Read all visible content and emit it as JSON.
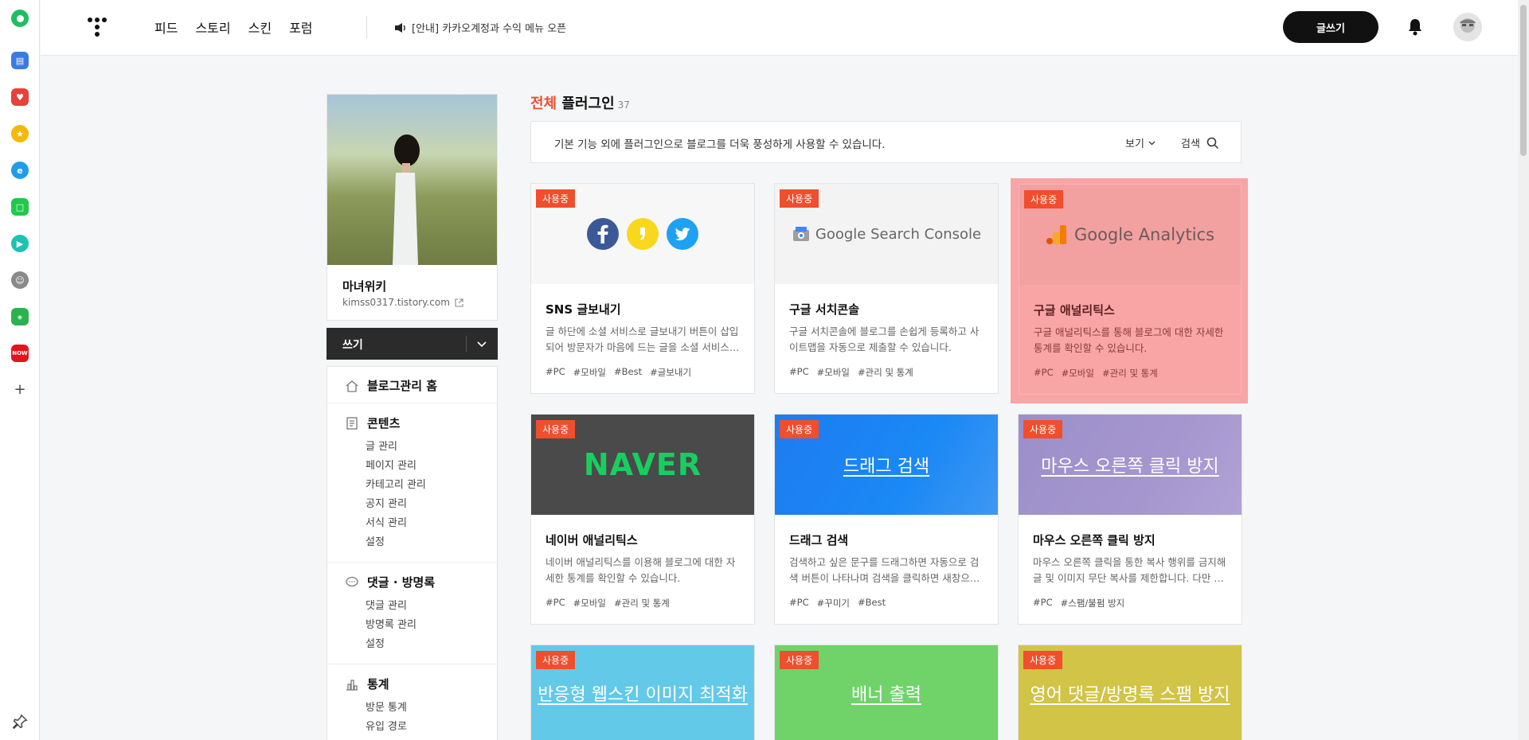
{
  "nav": {
    "items": [
      "피드",
      "스토리",
      "스킨",
      "포럼"
    ]
  },
  "notice": {
    "text": "[안내] 카카오계정과 수익 메뉴 오픈"
  },
  "header": {
    "write_label": "글쓰기"
  },
  "profile": {
    "blog_name": "마녀위키",
    "url": "kimss0317.tistory.com"
  },
  "write_bar": {
    "label": "쓰기"
  },
  "menu": {
    "home": "블로그관리 홈",
    "content": {
      "title": "콘텐츠",
      "items": [
        "글 관리",
        "페이지 관리",
        "카테고리 관리",
        "공지 관리",
        "서식 관리",
        "설정"
      ]
    },
    "comments": {
      "title": "댓글 · 방명록",
      "items": [
        "댓글 관리",
        "방명록 관리",
        "설정"
      ]
    },
    "stats": {
      "title": "통계",
      "items": [
        "방문 통계",
        "유입 경로"
      ]
    }
  },
  "main": {
    "title_accent": "전체",
    "title": "플러그인",
    "count": "37",
    "description": "기본 기능 외에 플러그인으로 블로그를 더욱 풍성하게 사용할 수 있습니다.",
    "view_label": "보기",
    "search_label": "검색"
  },
  "cards": [
    {
      "badge": "사용중",
      "title": "SNS 글보내기",
      "desc": "글 하단에 소셜 서비스로 글보내기 버튼이 삽입되어 방문자가 마음에 드는 글을 소셜 서비스…",
      "tags": [
        "#PC",
        "#모바일",
        "#Best",
        "#글보내기"
      ]
    },
    {
      "badge": "사용중",
      "title": "구글 서치콘솔",
      "logo_text": "Google Search Console",
      "desc": "구글 서치콘솔에 블로그를 손쉽게 등록하고 사이트맵을 자동으로 제출할 수 있습니다.",
      "tags": [
        "#PC",
        "#모바일",
        "#관리 및 통계"
      ]
    },
    {
      "badge": "사용중",
      "title": "구글 애널리틱스",
      "logo_text": "Google Analytics",
      "desc": "구글 애널리틱스를 통해 블로그에 대한 자세한 통계를 확인할 수 있습니다.",
      "tags": [
        "#PC",
        "#모바일",
        "#관리 및 통계"
      ]
    },
    {
      "badge": "사용중",
      "title": "네이버 애널리틱스",
      "logo_text": "NAVER",
      "desc": "네이버 애널리틱스를 이용해 블로그에 대한 자세한 통계를 확인할 수 있습니다.",
      "tags": [
        "#PC",
        "#모바일",
        "#관리 및 통계"
      ]
    },
    {
      "badge": "사용중",
      "title": "드래그 검색",
      "top_text": "드래그 검색",
      "desc": "검색하고 싶은 문구를 드래그하면 자동으로 검색 버튼이 나타나며 검색을 클릭하면 새창으…",
      "tags": [
        "#PC",
        "#꾸미기",
        "#Best"
      ]
    },
    {
      "badge": "사용중",
      "title": "마우스 오른쪽 클릭 방지",
      "top_text": "마우스 오른쪽 클릭 방지",
      "desc": "마우스 오른쪽 클릭을 통한 복사 행위를 금지해 글 및 이미지 무단 복사를 제한합니다. 다만 …",
      "tags": [
        "#PC",
        "#스팸/불펌 방지"
      ]
    },
    {
      "badge": "사용중",
      "top_text": "반응형 웹스킨 이미지 최적화"
    },
    {
      "badge": "사용중",
      "top_text": "배너 출력"
    },
    {
      "badge": "사용중",
      "top_text": "영어 댓글/방명록 스팸 방지"
    }
  ],
  "colors": {
    "accent": "#e8502f",
    "badge": "#f04e2d",
    "selected": "#f9a5a5"
  }
}
